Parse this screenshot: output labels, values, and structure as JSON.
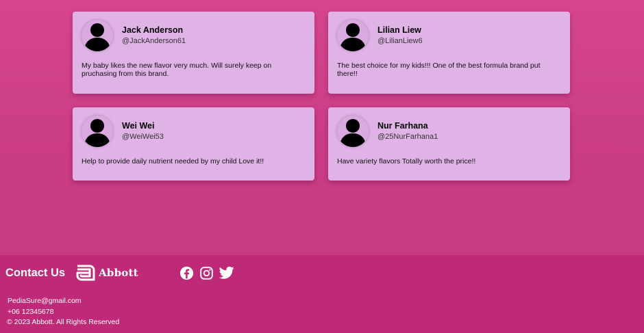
{
  "reviews": [
    {
      "name": "Jack Anderson",
      "handle": "@JackAnderson61",
      "comment": "My baby likes the new flavor very much. Will surely keep on pruchasing from this brand."
    },
    {
      "name": "Lilian Liew",
      "handle": "@LilianLiew6",
      "comment": "The best choice for my kids!!! One of the best formula brand put there!!"
    },
    {
      "name": "Wei Wei",
      "handle": "@WeiWei53",
      "comment": "Help to provide daily nutrient needed by my child Love it!!"
    },
    {
      "name": "Nur Farhana",
      "handle": "@25NurFarhana1",
      "comment": "Have variety flavors Totally worth the price!!"
    }
  ],
  "footer": {
    "contact_title": "Contact Us",
    "brand_name": "Abbott",
    "socials": [
      "facebook-icon",
      "instagram-icon",
      "twitter-icon"
    ],
    "email": "PediaSure@gmail.com",
    "phone": "+06 12345678",
    "copyright": "© 2023 Abbott. All Rights Reserved"
  },
  "colors": {
    "background": "#d6468f",
    "card": "#dfb3e6",
    "footer": "#be2a77"
  }
}
